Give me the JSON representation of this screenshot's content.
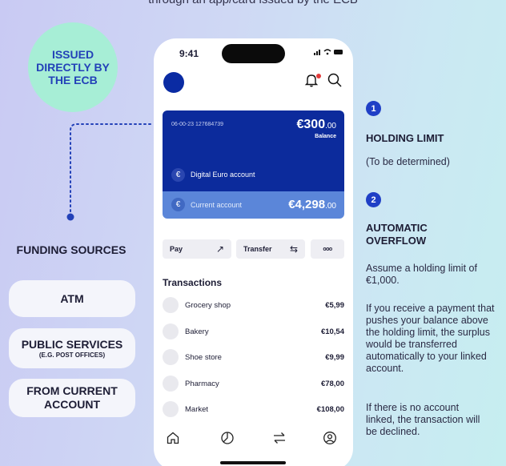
{
  "caption": "through an app/card issued by the ECB",
  "badge": {
    "text": "ISSUED DIRECTLY BY THE ECB",
    "color": "#a7eed6"
  },
  "funding": {
    "title": "FUNDING SOURCES",
    "items": [
      {
        "label": "ATM",
        "sub": ""
      },
      {
        "label": "PUBLIC SERVICES",
        "sub": "(E.G. POST OFFICES)"
      },
      {
        "label": "FROM CURRENT ACCOUNT",
        "sub": ""
      }
    ]
  },
  "phone": {
    "status_time": "9:41",
    "digital_euro_card": {
      "account_number": "06-00-23  127684739",
      "amount_main": "€300",
      "amount_cents": ".00",
      "balance_label": "Balance",
      "name": "Digital Euro account",
      "currency_symbol": "€",
      "color": "#0c2b9c"
    },
    "current_account_card": {
      "name": "Current account",
      "amount_main": "€4,298",
      "amount_cents": ".00",
      "currency_symbol": "€",
      "color": "#5b86d9"
    },
    "actions": [
      {
        "label": "Pay",
        "icon": "arrow-up-right-icon",
        "glyph": "↗"
      },
      {
        "label": "Transfer",
        "icon": "transfer-arrows-icon",
        "glyph": "⇆"
      },
      {
        "label": "",
        "icon": "more-dots-icon",
        "glyph": "ooo"
      }
    ],
    "transactions_title": "Transactions",
    "transactions": [
      {
        "name": "Grocery shop",
        "amount": "€5,99"
      },
      {
        "name": "Bakery",
        "amount": "€10,54"
      },
      {
        "name": "Shoe store",
        "amount": "€9,99"
      },
      {
        "name": "Pharmacy",
        "amount": "€78,00"
      },
      {
        "name": "Market",
        "amount": "€108,00"
      }
    ],
    "nav_icons": [
      "home-icon",
      "chart-icon",
      "transfer-icon",
      "profile-icon"
    ]
  },
  "notes": [
    {
      "number": "1",
      "heading": "HOLDING LIMIT",
      "paragraphs": [
        "(To be determined)"
      ]
    },
    {
      "number": "2",
      "heading": "AUTOMATIC OVERFLOW",
      "paragraphs": [
        "Assume a holding limit of €1,000.",
        "If you receive a payment that pushes your balance above the holding limit, the surplus would be transferred automatically to your linked account.",
        "If there is no account linked, the transaction will be declined."
      ]
    }
  ],
  "accent_color": "#1f3fc6"
}
